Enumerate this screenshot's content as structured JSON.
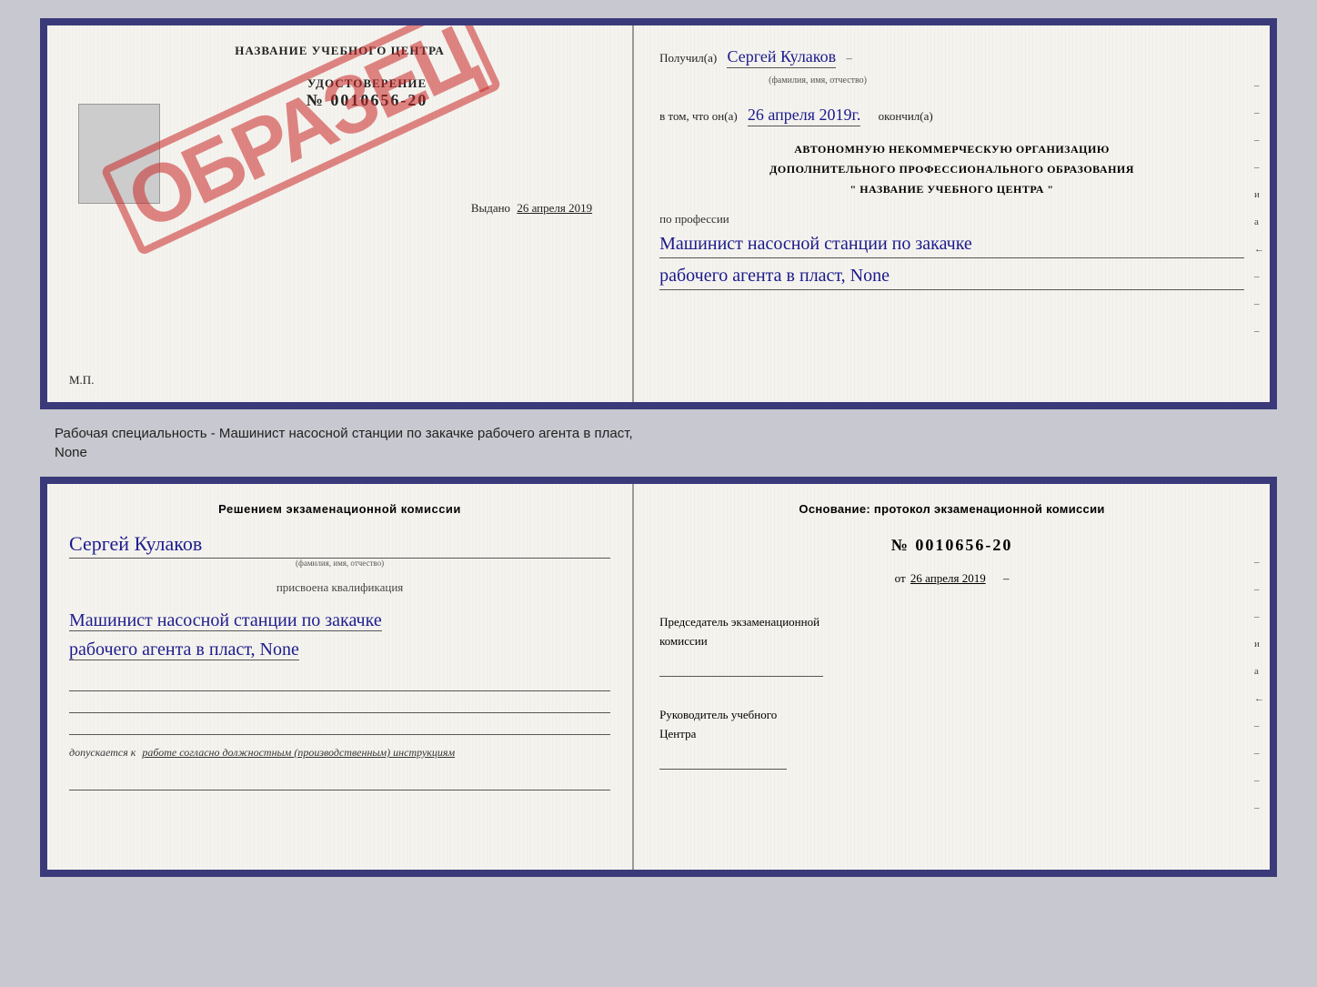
{
  "topDoc": {
    "left": {
      "certTitle": "НАЗВАНИЕ УЧЕБНОГО ЦЕНТРА",
      "certLabel": "УДОСТОВЕРЕНИЕ",
      "certNumber": "№ 0010656-20",
      "issuedLabel": "Выдано",
      "issuedDate": "26 апреля 2019",
      "mpLabel": "М.П.",
      "stampText": "ОБРАЗЕЦ"
    },
    "right": {
      "receivedLabel": "Получил(а)",
      "receivedName": "Сергей Кулаков",
      "nameHint": "(фамилия, имя, отчество)",
      "inThatLabel": "в том, что он(а)",
      "completedDate": "26 апреля 2019г.",
      "completedLabel": "окончил(а)",
      "orgLine1": "АВТОНОМНУЮ НЕКОММЕРЧЕСКУЮ ОРГАНИЗАЦИЮ",
      "orgLine2": "ДОПОЛНИТЕЛЬНОГО ПРОФЕССИОНАЛЬНОГО ОБРАЗОВАНИЯ",
      "orgLine3": "\"   НАЗВАНИЕ УЧЕБНОГО ЦЕНТРА   \"",
      "professionLabel": "по профессии",
      "professionLine1": "Машинист насосной станции по закачке",
      "professionLine2": "рабочего агента в пласт, None",
      "sideMarks": [
        "-",
        "-",
        "-",
        "-",
        "и",
        "а",
        "←",
        "-",
        "-",
        "-"
      ]
    }
  },
  "caption": {
    "line1": "Рабочая специальность - Машинист насосной станции по закачке рабочего агента в пласт,",
    "line2": "None"
  },
  "bottomDoc": {
    "left": {
      "decisionText": "Решением  экзаменационной  комиссии",
      "personName": "Сергей Кулаков",
      "nameHint": "(фамилия, имя, отчество)",
      "assignedText": "присвоена квалификация",
      "qualLine1": "Машинист насосной станции по закачке",
      "qualLine2": "рабочего агента в пласт, None",
      "lines": [
        "",
        "",
        ""
      ],
      "допускLabel": "допускается к",
      "допускValue": "работе согласно должностным (производственным) инструкциям",
      "bottomLine": ""
    },
    "right": {
      "basisText": "Основание: протокол экзаменационной  комиссии",
      "protocolNumber": "№ 0010656-20",
      "datePrefix": "от",
      "date": "26 апреля 2019",
      "chairmanLine1": "Председатель экзаменационной",
      "chairmanLine2": "комиссии",
      "sigLine": "",
      "directorLine1": "Руководитель учебного",
      "directorLine2": "Центра",
      "directorSigLine": "",
      "sideMarks": [
        "-",
        "-",
        "-",
        "и",
        "а",
        "←",
        "-",
        "-",
        "-",
        "-"
      ]
    }
  }
}
